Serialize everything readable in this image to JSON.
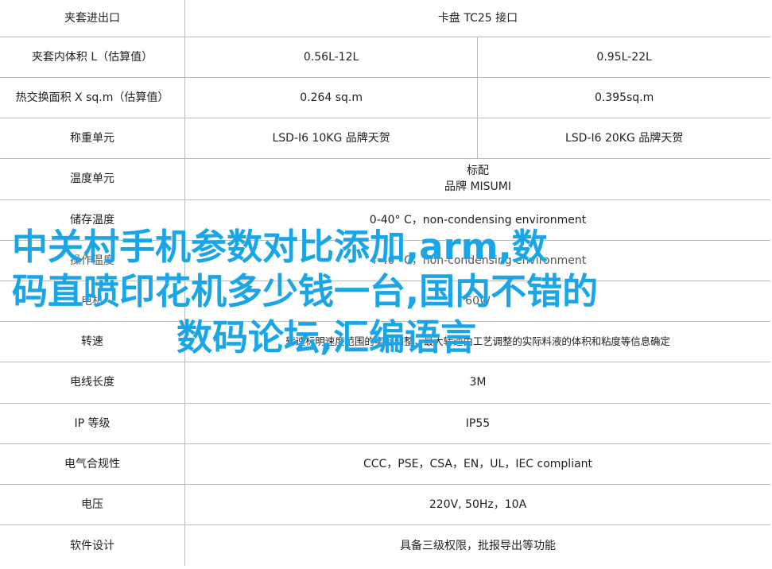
{
  "spec_table": {
    "rows": [
      {
        "label": "夹套进出口",
        "span": true,
        "value": "卡盘 TC25 接口"
      },
      {
        "label": "夹套内体积 L（估算值）",
        "span": false,
        "values": [
          "0.56L-12L",
          "0.95L-22L"
        ]
      },
      {
        "label": "热交换面积 X sq.m（估算值）",
        "span": false,
        "values": [
          "0.264 sq.m",
          "0.395sq.m"
        ]
      },
      {
        "label": "称重单元",
        "span": false,
        "values": [
          "LSD-I6 10KG 品牌天贺",
          "LSD-I6 20KG 品牌天贺"
        ]
      },
      {
        "label": "温度单元",
        "span": true,
        "value_lines": [
          "标配",
          "品牌 MISUMI"
        ]
      },
      {
        "label": "储存温度",
        "span": true,
        "value": "0-40° C，non-condensing environment"
      },
      {
        "label": "操作温度",
        "span": true,
        "value": "4-40° C，non-condensing environment"
      },
      {
        "label": "电机",
        "span": true,
        "value": "60W"
      },
      {
        "label": "转速",
        "span": true,
        "value": "转速标明速度范围的实际调整，最大转速由工艺调整的实际料液的体积和粘度等信息确定"
      },
      {
        "label": "电线长度",
        "span": true,
        "value": "3M"
      },
      {
        "label": "IP 等级",
        "span": true,
        "value": "IP55"
      },
      {
        "label": "电气合规性",
        "span": true,
        "value": "CCC，PSE，CSA，EN，UL，IEC compliant"
      },
      {
        "label": "电压",
        "span": true,
        "value": "220V, 50Hz，10A"
      },
      {
        "label": "软件设计",
        "span": true,
        "value": "具备三级权限，批报导出等功能"
      }
    ]
  },
  "overlay": {
    "line1": "中关村手机参数对比添加,arm,数",
    "line2": "码直喷印花机多少钱一台,国内不错的",
    "line3": "数码论坛,汇编语言",
    "color": "#1aa6e6"
  }
}
